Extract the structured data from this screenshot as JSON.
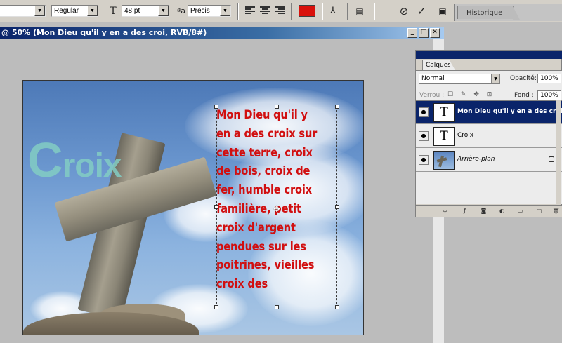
{
  "options_bar": {
    "font_style": "Regular",
    "font_size": "48 pt",
    "antialias": "Précis",
    "text_color": "#d9110b"
  },
  "history_panel": {
    "tab_label": "Historique"
  },
  "document": {
    "title": "@ 50% (Mon Dieu qu'il y en a des croi, RVB/8#)",
    "heading_letter": "C",
    "heading_rest": "roix",
    "paragraph": "Mon Dieu qu'il y\nen a des croix sur\ncette terre, croix\nde bois, croix de\nfer, humble croix\nfamilière, petit\ncroix d'argent\npendues sur les\npoitrines, vieilles\ncroix des"
  },
  "layers_panel": {
    "tab_label": "Calques",
    "blend_mode": "Normal",
    "opacity_label": "Opacité:",
    "opacity_value": "100%",
    "lock_label": "Verrou :",
    "fill_label": "Fond :",
    "fill_value": "100%",
    "layers": [
      {
        "name": "Mon Dieu qu'il y en a des croi",
        "thumb": "T",
        "selected": true
      },
      {
        "name": "Croix",
        "thumb": "T",
        "selected": false
      },
      {
        "name": "Arrière-plan",
        "thumb": "",
        "selected": false,
        "locked": true
      }
    ]
  }
}
